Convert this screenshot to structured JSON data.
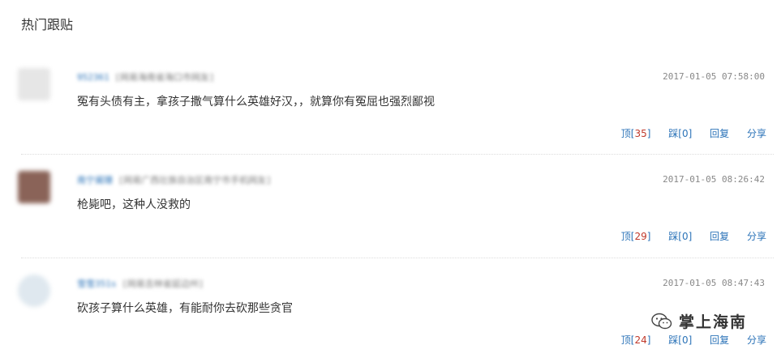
{
  "section_title": "热门跟贴",
  "comments": [
    {
      "user_name": "952361",
      "user_loc": "[网易海南省海口市网友]",
      "time": "2017-01-05 07:58:00",
      "text": "冤有头债有主，拿孩子撒气算什么英雄好汉，，就算你有冤屈也强烈鄙视",
      "up": "35",
      "down": "0"
    },
    {
      "user_name": "南宁阑珊",
      "user_loc": "[网易广西壮族自治区南宁市手机网友]",
      "time": "2017-01-05 08:26:42",
      "text": "枪毙吧，这种人没救的",
      "up": "29",
      "down": "0"
    },
    {
      "user_name": "雪雪351s",
      "user_loc": "[网易吉林省延边州]",
      "time": "2017-01-05 08:47:43",
      "text": "砍孩子算什么英雄，有能耐你去砍那些贪官",
      "up": "24",
      "down": "0"
    }
  ],
  "actions": {
    "up_label": "顶",
    "down_label": "踩",
    "reply_label": "回复",
    "share_label": "分享"
  },
  "watermark": {
    "text": "掌上海南",
    "icon": "wechat-icon"
  },
  "colors": {
    "link": "#2b73b8",
    "count": "#c0392b",
    "text": "#333333",
    "meta": "#888888"
  }
}
